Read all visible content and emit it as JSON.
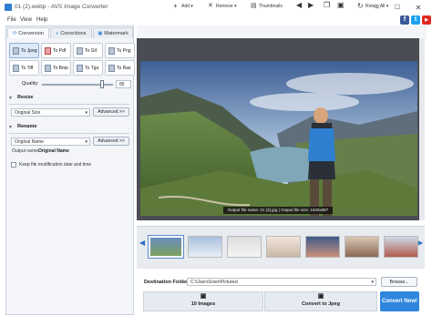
{
  "window": {
    "title": "01 (2).webp - AVS Image Converter",
    "controls": {
      "minimize": "–",
      "maximize": "☐",
      "close": "✕"
    }
  },
  "menu": {
    "items": [
      "File",
      "View",
      "Help"
    ]
  },
  "social": {
    "facebook": "f",
    "twitter": "t",
    "youtube": "▶"
  },
  "tabs": [
    {
      "label": "Conversion",
      "icon": "conversion-icon"
    },
    {
      "label": "Corrections",
      "icon": "corrections-icon"
    },
    {
      "label": "Watermark",
      "icon": "watermark-icon"
    }
  ],
  "formats": [
    "To Jpeg",
    "To Pdf",
    "To Gif",
    "To Png",
    "To Tiff",
    "To Bmp",
    "To Tga",
    "To Ras"
  ],
  "quality": {
    "label": "Quality:",
    "value": "85",
    "fraction": 0.85
  },
  "resize": {
    "title": "Resize",
    "combo_value": "Original Size",
    "advanced_label": "Advanced >>"
  },
  "rename": {
    "title": "Rename",
    "combo_value": "Original Name",
    "advanced_label": "Advanced >>",
    "output_name_label": "Output name:",
    "output_name_value": "Original Name"
  },
  "keep_date_label": "Keep file modification date and time",
  "toolbar": {
    "add": "Add",
    "remove": "Remove",
    "thumbnails": "Thumbnails",
    "rotate_all": "Rotate All"
  },
  "preview": {
    "info": "Output file name: 01 (2).jpg | Output file size: 1920x987"
  },
  "destination": {
    "label": "Destination Folder:",
    "path": "C:\\Users\\User\\Pictures\\",
    "browse_label": "Browse..."
  },
  "bottom": {
    "images_count": "10 Images",
    "convert_to": "Convert to Jpeg",
    "convert_now": "Convert Now!"
  },
  "colors": {
    "accent": "#2f86dd",
    "panel_bg": "#f3f5f8",
    "preview_bg": "#4a4d53"
  }
}
